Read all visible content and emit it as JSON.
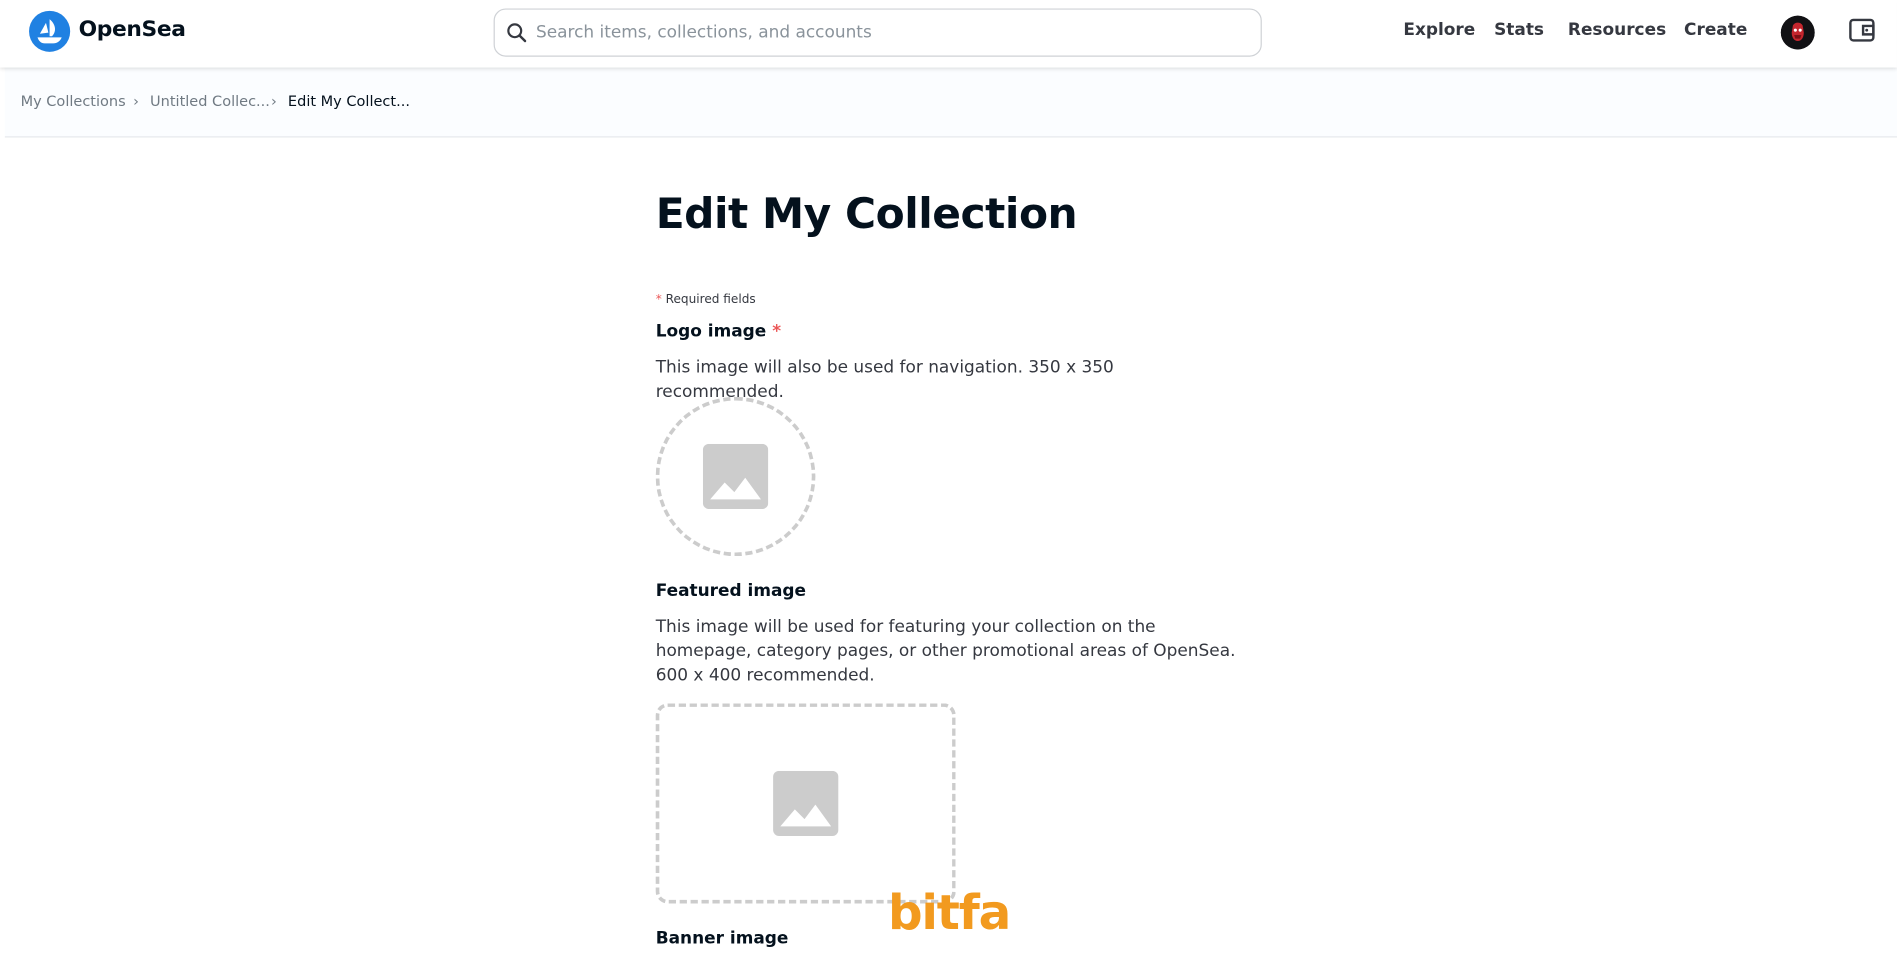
{
  "header": {
    "brand": "OpenSea",
    "search": {
      "placeholder": "Search items, collections, and accounts",
      "value": ""
    },
    "nav": [
      {
        "label": "Explore"
      },
      {
        "label": "Stats"
      },
      {
        "label": "Resources"
      },
      {
        "label": "Create"
      }
    ],
    "icons": {
      "logo": "opensea-boat-logo",
      "search": "search-icon",
      "wallet": "wallet-icon",
      "avatar": "user-avatar"
    },
    "brand_color": "#2081e2"
  },
  "breadcrumb": [
    {
      "label": "My Collections"
    },
    {
      "label": "Untitled Collec..."
    },
    {
      "label": "Edit My Collect..."
    }
  ],
  "breadcrumb_separator": "›",
  "form": {
    "title": "Edit My Collection",
    "required_marker": "*",
    "required_note": "Required fields",
    "logo": {
      "label": "Logo image",
      "description": "This image will also be used for navigation. 350 x 350 recommended."
    },
    "featured": {
      "label": "Featured image",
      "description": "This image will be used for featuring your collection on the homepage, category pages, or other promotional areas of OpenSea. 600 x 400 recommended."
    },
    "banner": {
      "label": "Banner image"
    },
    "required_color": "#eb5757",
    "placeholder_icon": "image-placeholder-icon"
  },
  "watermark": "bitfa",
  "watermark_color": "#f29a1f"
}
